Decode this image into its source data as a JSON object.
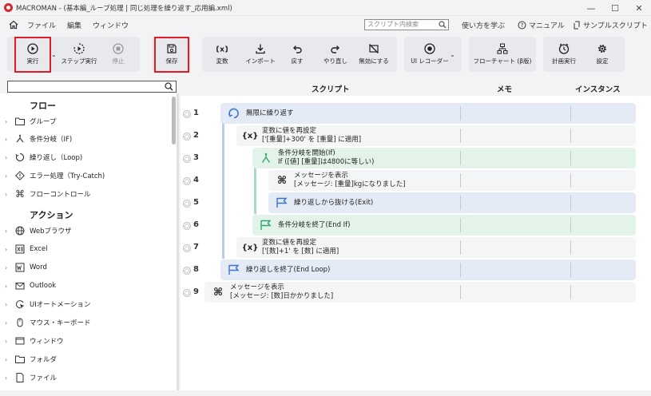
{
  "window": {
    "title": "MACROMAN - (基本編_ループ処理 | 同じ処理を繰り返す_応用編.xml)",
    "controls": [
      "—",
      "☐",
      "✕"
    ]
  },
  "menu": [
    "ファイル",
    "編集",
    "ウィンドウ"
  ],
  "search": {
    "placeholder": "スクリプト内検索"
  },
  "help_links": {
    "learn": "使い方を学ぶ",
    "manual": "マニュアル",
    "samples": "サンプルスクリプト"
  },
  "ribbon": {
    "run": "実行",
    "step_run": "ステップ実行",
    "stop": "停止",
    "save": "保存",
    "variable": "変数",
    "import": "インポート",
    "undo": "戻す",
    "redo": "やり直し",
    "disable": "無効にする",
    "ui_recorder": "UI レコーダー",
    "flowchart": "フローチャート (β版)",
    "scheduled_run": "計画実行",
    "settings": "設定"
  },
  "left_panel": {
    "flow_heading": "フロー",
    "flow_items": [
      "グループ",
      "条件分岐（IF)",
      "繰り返し（Loop)",
      "エラー処理（Try-Catch)",
      "フローコントロール"
    ],
    "action_heading": "アクション",
    "action_items": [
      "Webブラウザ",
      "Excel",
      "Word",
      "Outlook",
      "UIオートメーション",
      "マウス・キーボード",
      "ウィンドウ",
      "フォルダ",
      "ファイル"
    ]
  },
  "columns": {
    "script": "スクリプト",
    "memo": "メモ",
    "instance": "インスタンス"
  },
  "rows": [
    {
      "num": "1",
      "line1": "無限に繰り返す",
      "line2": ""
    },
    {
      "num": "2",
      "line1": "変数に値を再設定",
      "line2": "['[重量]+300' を [重量] に適用]"
    },
    {
      "num": "3",
      "line1": "条件分岐を開始(If)",
      "line2": "If ([値] [重量]は4800に等しい)"
    },
    {
      "num": "4",
      "line1": "メッセージを表示",
      "line2": "[メッセージ: [重量]kgになりました]"
    },
    {
      "num": "5",
      "line1": "繰り返しから抜ける(Exit)",
      "line2": ""
    },
    {
      "num": "6",
      "line1": "条件分岐を終了(End If)",
      "line2": ""
    },
    {
      "num": "7",
      "line1": "変数に値を再設定",
      "line2": "['[数]+1' を [数] に適用]"
    },
    {
      "num": "8",
      "line1": "繰り返しを終了(End Loop)",
      "line2": ""
    },
    {
      "num": "9",
      "line1": "メッセージを表示",
      "line2": "[メッセージ: [数]日かかりました]"
    }
  ]
}
